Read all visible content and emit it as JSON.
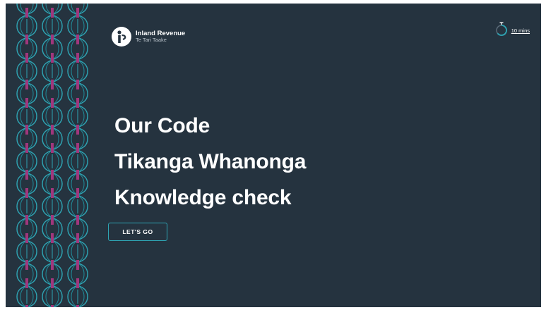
{
  "brand": {
    "name": "Inland Revenue",
    "subname": "Te Tari Taake",
    "icon": "inland-revenue-logo"
  },
  "timer": {
    "label": "10 mins",
    "icon": "stopwatch-icon"
  },
  "title": {
    "lines": [
      "Our Code",
      "Tikanga Whanonga",
      "Knowledge check"
    ]
  },
  "start_button": {
    "label": "LET'S GO"
  },
  "colors": {
    "background": "#25333f",
    "accent_teal": "#2ea6b5",
    "accent_magenta": "#a0377d",
    "text": "#ffffff"
  }
}
